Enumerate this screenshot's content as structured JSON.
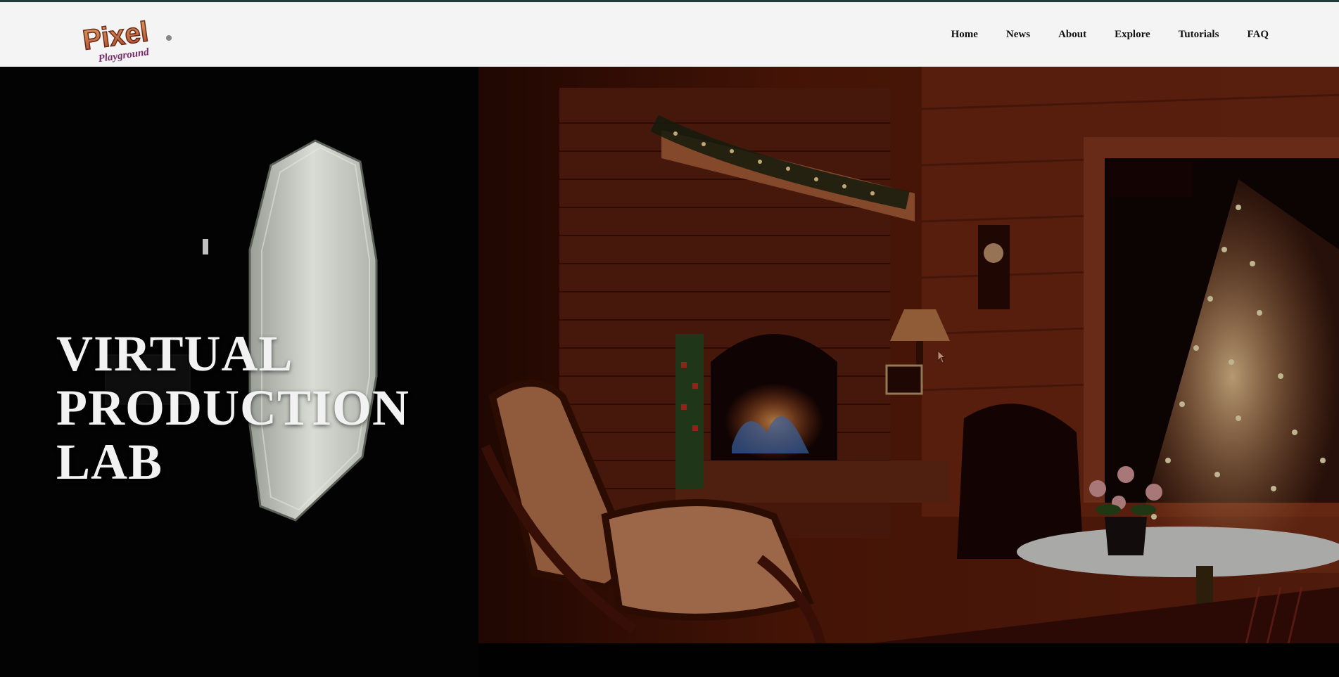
{
  "brand": {
    "logo_text": "Pixel",
    "logo_subtext": "Playground"
  },
  "nav": {
    "items": [
      {
        "label": "Home"
      },
      {
        "label": "News"
      },
      {
        "label": "About"
      },
      {
        "label": "Explore"
      },
      {
        "label": "Tutorials"
      },
      {
        "label": "FAQ"
      }
    ]
  },
  "hero": {
    "title_lines": [
      "VIRTUAL",
      "PRODUCTION",
      "LAB"
    ]
  },
  "colors": {
    "header_bg": "#f4f4f4",
    "nav_text": "#111111",
    "hero_bg": "#030303",
    "hero_title": "#f2f2f2",
    "logo_primary": "#b7472a",
    "logo_secondary": "#7a2a6a"
  }
}
